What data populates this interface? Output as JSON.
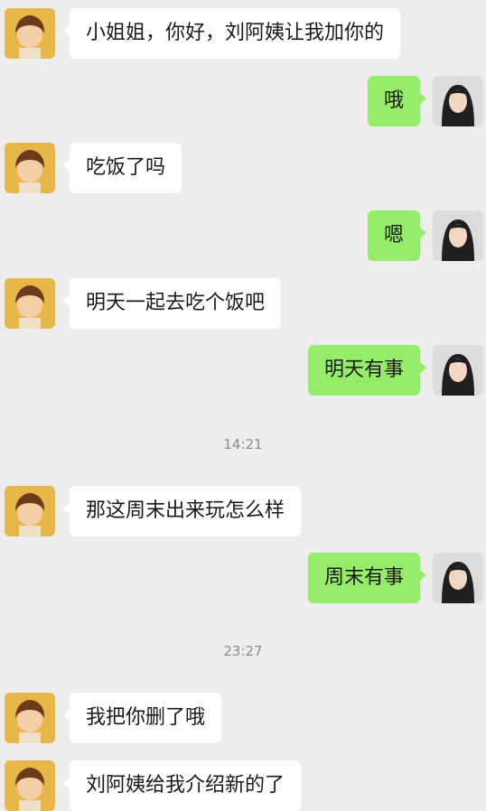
{
  "messages": [
    {
      "side": "in",
      "text": "小姐姐，你好，刘阿姨让我加你的"
    },
    {
      "side": "out",
      "text": "哦"
    },
    {
      "side": "in",
      "text": "吃饭了吗"
    },
    {
      "side": "out",
      "text": "嗯"
    },
    {
      "side": "in",
      "text": "明天一起去吃个饭吧"
    },
    {
      "side": "out",
      "text": "明天有事"
    },
    {
      "side": "in",
      "text": "那这周末出来玩怎么样"
    },
    {
      "side": "out",
      "text": "周末有事"
    },
    {
      "side": "in",
      "text": "我把你删了哦"
    },
    {
      "side": "in",
      "text": "刘阿姨给我介绍新的了"
    }
  ],
  "timestamps": [
    "14:21",
    "23:27"
  ],
  "colors": {
    "background": "#ededed",
    "incoming_bubble": "#ffffff",
    "outgoing_bubble": "#95ec69"
  },
  "avatars": {
    "incoming": "boy-avatar",
    "outgoing": "girl-avatar"
  }
}
